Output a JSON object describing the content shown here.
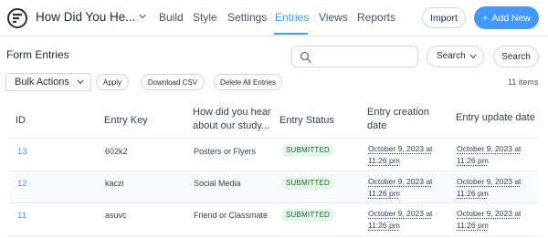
{
  "header": {
    "form_title": "How Did You He...",
    "nav": [
      {
        "label": "Build",
        "active": false
      },
      {
        "label": "Style",
        "active": false
      },
      {
        "label": "Settings",
        "active": false
      },
      {
        "label": "Entries",
        "active": true
      },
      {
        "label": "Views",
        "active": false
      },
      {
        "label": "Reports",
        "active": false
      }
    ],
    "import_label": "Import",
    "add_new_label": "Add New",
    "accent_color": "#4199fd"
  },
  "toolbar": {
    "heading": "Form Entries",
    "search_placeholder": "",
    "search_field_selected": "Search",
    "search_button": "Search",
    "bulk_actions_selected": "Bulk Actions",
    "apply_label": "Apply",
    "download_csv_label": "Download CSV",
    "delete_all_label": "Delete All Entries",
    "items_count": "11 items"
  },
  "table": {
    "columns": [
      "ID",
      "Entry Key",
      "How did you hear about our study...",
      "Entry Status",
      "Entry creation date",
      "Entry update date"
    ],
    "rows": [
      {
        "id": "13",
        "key": "602k2",
        "source": "Posters or Flyers",
        "status": "SUBMITTED",
        "created_line1": "October 9, 2023 at",
        "created_line2": "11:26 pm",
        "updated_line1": "October 9, 2023 at",
        "updated_line2": "11:26 pm"
      },
      {
        "id": "12",
        "key": "kaczi",
        "source": "Social Media",
        "status": "SUBMITTED",
        "created_line1": "October 9, 2023 at",
        "created_line2": "11:26 pm",
        "updated_line1": "October 9, 2023 at",
        "updated_line2": "11:26 pm"
      },
      {
        "id": "11",
        "key": "asuvc",
        "source": "Friend or Classmate",
        "status": "SUBMITTED",
        "created_line1": "October 9, 2023 at",
        "created_line2": "11:26 pm",
        "updated_line1": "October 9, 2023 at",
        "updated_line2": "11:26 pm"
      }
    ]
  }
}
